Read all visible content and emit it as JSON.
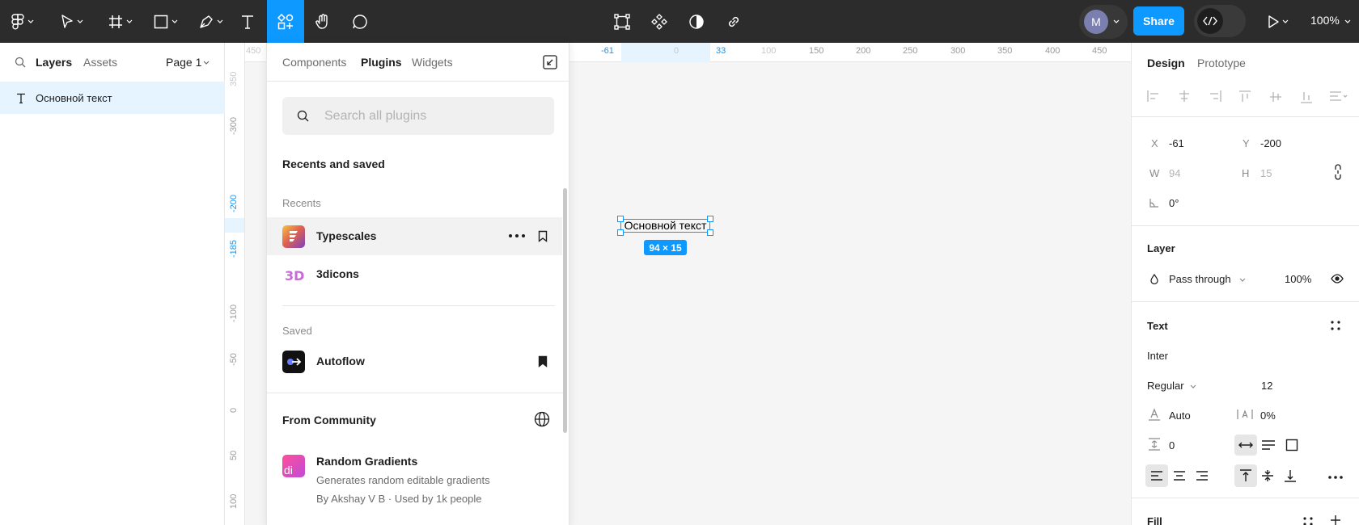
{
  "toolbar": {
    "share_label": "Share",
    "avatar_initial": "M",
    "zoom": "100%"
  },
  "left_panel": {
    "tabs": [
      {
        "label": "Layers"
      },
      {
        "label": "Assets"
      }
    ],
    "page_label": "Page 1",
    "layers": [
      {
        "name": "Основной текст"
      }
    ]
  },
  "rulers": {
    "horizontal": [
      "450",
      "-61",
      "0",
      "33",
      "100",
      "150",
      "200",
      "250",
      "300",
      "350",
      "400",
      "450"
    ],
    "vertical": [
      "350",
      "-300",
      "-200",
      "-185",
      "-100",
      "-50",
      "0",
      "50",
      "100"
    ]
  },
  "canvas": {
    "text_content": "Основной текст",
    "size_badge": "94 × 15"
  },
  "resources": {
    "tabs": [
      {
        "label": "Components"
      },
      {
        "label": "Plugins"
      },
      {
        "label": "Widgets"
      }
    ],
    "search_placeholder": "Search all plugins",
    "recents_and_saved": "Recents and saved",
    "recents_label": "Recents",
    "recents": [
      {
        "name": "Typescales"
      },
      {
        "name": "3dicons"
      }
    ],
    "saved_label": "Saved",
    "saved": [
      {
        "name": "Autoflow"
      }
    ],
    "community_label": "From Community",
    "community": [
      {
        "name": "Random Gradients",
        "description": "Generates random editable gradients",
        "meta": "By Akshay V B · Used by 1k people",
        "icon_text": "di"
      }
    ]
  },
  "design_panel": {
    "tabs": [
      {
        "label": "Design"
      },
      {
        "label": "Prototype"
      }
    ],
    "x_label": "X",
    "x_value": "-61",
    "y_label": "Y",
    "y_value": "-200",
    "w_label": "W",
    "w_value": "94",
    "h_label": "H",
    "h_value": "15",
    "rotation": "0°",
    "layer_title": "Layer",
    "blend_mode": "Pass through",
    "opacity": "100%",
    "text_title": "Text",
    "font_family": "Inter",
    "font_weight": "Regular",
    "font_size": "12",
    "line_height": "Auto",
    "letter_spacing": "0%",
    "paragraph_spacing": "0",
    "fill_title": "Fill"
  },
  "colors": {
    "accent": "#0d99ff",
    "toolbar_bg": "#2c2c2c",
    "selection_bg": "#e5f4ff"
  }
}
